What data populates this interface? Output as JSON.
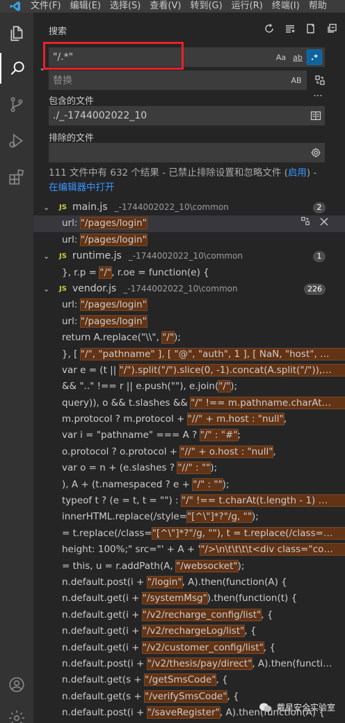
{
  "menu": [
    "文件(F)",
    "编辑(E)",
    "选择(S)",
    "查看(V)",
    "转到(G)",
    "运行(R)",
    "终端(I)",
    "帮助"
  ],
  "sidebar": {
    "title": "搜索"
  },
  "search": {
    "query": "\"/.*\"",
    "options": {
      "match_case": "Aa",
      "whole_word": "ab",
      "regex": ".*"
    },
    "replace_placeholder": "替换",
    "preserve_case": "AB"
  },
  "include": {
    "label": "包含的文件",
    "value": "./_-1744002022_10"
  },
  "exclude": {
    "label": "排除的文件",
    "value": ""
  },
  "summary": {
    "text": "111 文件中有 632 个结果 - 已禁止排除设置和忽略文件 (",
    "enable_link": "启用",
    "text_end": ") -",
    "open_in_editor": "在编辑器中打开"
  },
  "results": [
    {
      "file": "main.js",
      "path": "_-1744002022_10\\common",
      "count": "2",
      "lines": [
        {
          "pre": "url: ",
          "hl": "\"/pages/login\"",
          "post": ""
        },
        {
          "pre": "url: ",
          "hl": "\"/pages/login\"",
          "post": ""
        }
      ]
    },
    {
      "file": "runtime.js",
      "path": "_-1744002022_10\\common",
      "count": "1",
      "lines": [
        {
          "pre": "}, r.p = ",
          "hl": "\"/\"",
          "post": ", r.oe = function(e) {"
        }
      ]
    },
    {
      "file": "vendor.js",
      "path": "_-1744002022_10\\common",
      "count": "226",
      "lines": [
        {
          "pre": "url: ",
          "hl": "\"/pages/login\"",
          "post": ""
        },
        {
          "pre": "url: ",
          "hl": "\"/pages/login\"",
          "post": ""
        },
        {
          "pre": "return A.replace(\"\\\\\", ",
          "hl": "\"/\"",
          "post": ");"
        },
        {
          "pre": "}, [ ",
          "hl": "\"/\", \"pathname\" ], [ \"@\", \"auth\", 1 ], [ NaN, \"host\", void 0, 1, ...",
          "post": ""
        },
        {
          "pre": "var e = (t || ",
          "hl": "\"/\").split(\"/\").slice(0, -1).concat(A.split(\"/\")), n = e.le...",
          "post": ""
        },
        {
          "pre": "&& \"..\" !== r || e.push(\"\"), e.join(",
          "hl": "\"/\"",
          "post": ");"
        },
        {
          "pre": "query)), o && t.slashes && ",
          "hl": "\"/\" !== m.pathname.charAt(0) && ...",
          "post": ""
        },
        {
          "pre": "m.protocol ? m.protocol + ",
          "hl": "\"//\" + m.host : \"null\"",
          "post": ","
        },
        {
          "pre": "var i = \"pathname\" === A ? ",
          "hl": "\"/\" : \"#\"",
          "post": ";"
        },
        {
          "pre": "o.protocol ? o.protocol + ",
          "hl": "\"//\" + o.host : \"null\"",
          "post": ","
        },
        {
          "pre": "var o = n + (e.slashes ? ",
          "hl": "\"//\" : \"\"",
          "post": ");"
        },
        {
          "pre": "), A + (t.namespaced ? e + ",
          "hl": "\"/\" : \"\"",
          "post": ");"
        },
        {
          "pre": "typeof t ? (e = t, t = \"\") : ",
          "hl": "\"/\" !== t.charAt(t.length - 1) && (t +=...",
          "post": ""
        },
        {
          "pre": "innerHTML.replace(/style=",
          "hl": "\"[^\\\"]*?\"/g, \"\"",
          "post": ");"
        },
        {
          "pre": "= t.replace(/class=",
          "hl": "\"[^\\\"]*?\"/g, \"\"), t = t.replace(/class='[^\\']*?'/...",
          "post": ""
        },
        {
          "pre": "height: 100%;\" src=\"' + A + '",
          "hl": "\"/>\\n\\t\\t\\t\\t<div class=\"cover\" sty...",
          "post": ""
        },
        {
          "pre": "= this, u = r.addPath(A, ",
          "hl": "\"/websocket\"",
          "post": ");"
        },
        {
          "pre": "n.default.post(i + ",
          "hl": "\"/login\"",
          "post": ", A).then(function(A) {"
        },
        {
          "pre": "n.default.get(i + ",
          "hl": "\"/systemMsg\"",
          "post": ").then(function(t) {"
        },
        {
          "pre": "n.default.get(i + ",
          "hl": "\"/v2/recharge_config/list\"",
          "post": ", {"
        },
        {
          "pre": "n.default.get(i + ",
          "hl": "\"/v2/rechargeLog/list\"",
          "post": ", {"
        },
        {
          "pre": "n.default.get(i + ",
          "hl": "\"/v2/customer_config/list\"",
          "post": ", {"
        },
        {
          "pre": "n.default.post(i + ",
          "hl": "\"/v2/thesis/pay/direct\"",
          "post": ", A).then(function(A) {"
        },
        {
          "pre": "n.default.get(s + ",
          "hl": "\"/getSmsCode\"",
          "post": ", {"
        },
        {
          "pre": "n.default.get(s + ",
          "hl": "\"/verifySmsCode\"",
          "post": ", {"
        },
        {
          "pre": "n.default.post(i + ",
          "hl": "\"/saveRegister\"",
          "post": ", A).then(function(A) {"
        }
      ]
    }
  ],
  "watermark": "戴星安全实验室",
  "colors": {
    "highlight": "#623315",
    "regex_on": "#0e639c",
    "annotation": "#e8212a",
    "link": "#3794ff"
  }
}
